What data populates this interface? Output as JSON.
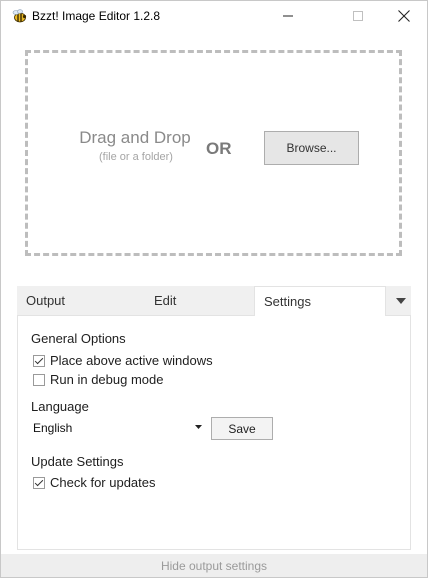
{
  "window": {
    "title": "Bzzt! Image Editor 1.2.8",
    "app_icon": "bee-icon"
  },
  "dropzone": {
    "title": "Drag and Drop",
    "subtitle": "(file or a folder)",
    "or_label": "OR",
    "browse_label": "Browse..."
  },
  "tabs": [
    {
      "label": "Output",
      "active": false
    },
    {
      "label": "Edit",
      "active": false
    },
    {
      "label": "Settings",
      "active": true
    }
  ],
  "settings": {
    "general_title": "General Options",
    "place_above_label": "Place above active windows",
    "place_above_checked": true,
    "debug_label": "Run in debug mode",
    "debug_checked": false,
    "language_title": "Language",
    "language_value": "English",
    "save_label": "Save",
    "update_title": "Update Settings",
    "check_updates_label": "Check for updates",
    "check_updates_checked": true
  },
  "footer": {
    "label": "Hide output settings"
  }
}
